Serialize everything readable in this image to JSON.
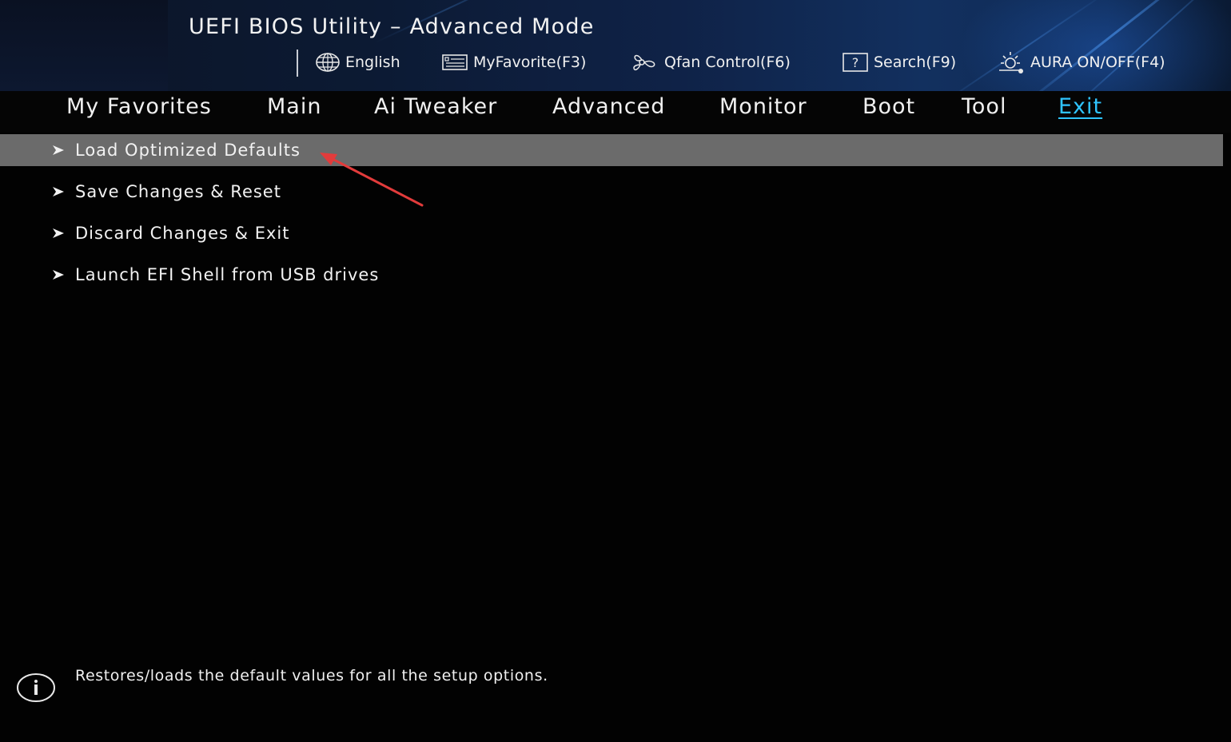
{
  "header": {
    "title": "UEFI BIOS Utility – Advanced Mode",
    "tools": {
      "language": {
        "label": "English",
        "icon": "globe-icon"
      },
      "favorite": {
        "label": "MyFavorite(F3)",
        "icon": "favorite-list-icon"
      },
      "qfan": {
        "label": "Qfan Control(F6)",
        "icon": "fan-icon"
      },
      "search": {
        "label": "Search(F9)",
        "icon": "help-search-icon"
      },
      "aura": {
        "label": "AURA ON/OFF(F4)",
        "icon": "aura-light-icon"
      }
    }
  },
  "tabs": {
    "favorites": "My Favorites",
    "main": "Main",
    "ai_tweaker": "Ai Tweaker",
    "advanced": "Advanced",
    "monitor": "Monitor",
    "boot": "Boot",
    "tool": "Tool",
    "exit": "Exit",
    "active": "Exit"
  },
  "menu": {
    "items": [
      {
        "label": "Load Optimized Defaults",
        "selected": true
      },
      {
        "label": "Save Changes & Reset",
        "selected": false
      },
      {
        "label": "Discard Changes & Exit",
        "selected": false
      },
      {
        "label": "Launch EFI Shell from USB drives",
        "selected": false
      }
    ]
  },
  "help": {
    "icon": "info-icon",
    "text": "Restores/loads the default values for all the setup options."
  },
  "colors": {
    "active_tab": "#2fc4ff",
    "selected_row": "#6b6b6b",
    "annotation_arrow": "#e23b3b",
    "header_accent": "#1f5fbf"
  }
}
